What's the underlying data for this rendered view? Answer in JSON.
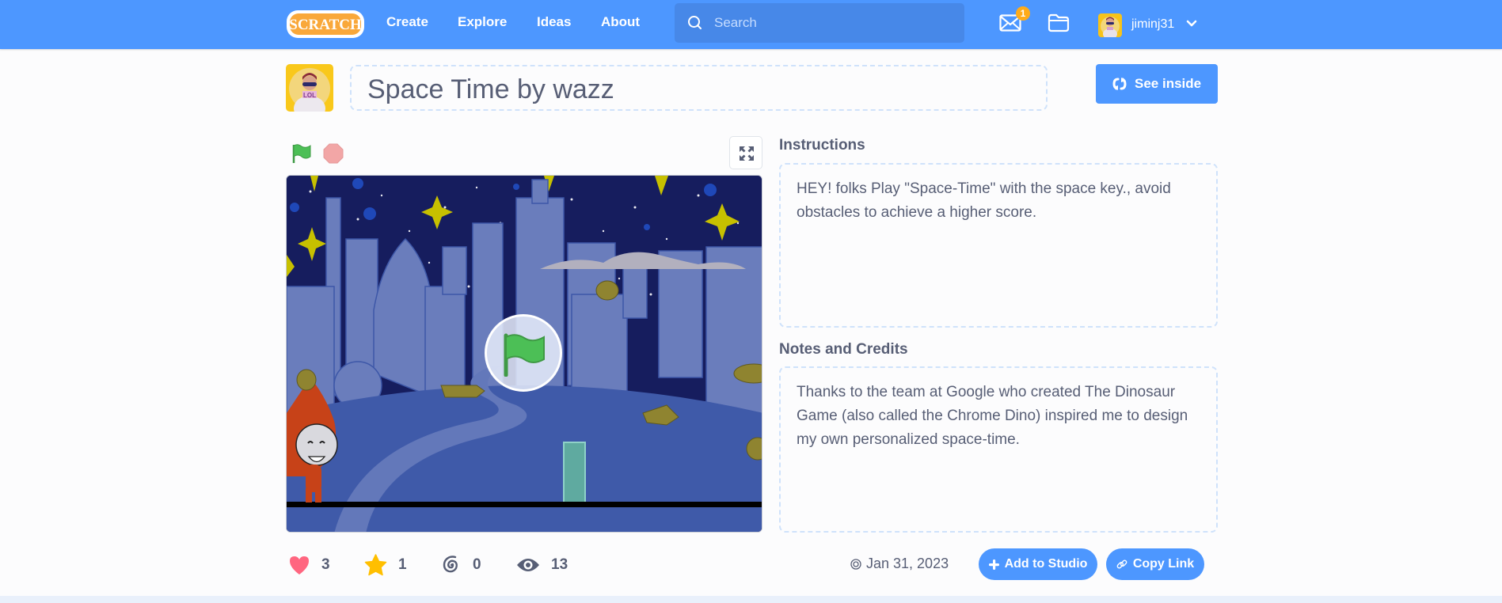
{
  "header": {
    "logo_text": "SCRATCH",
    "nav": [
      {
        "label": "Create"
      },
      {
        "label": "Explore"
      },
      {
        "label": "Ideas"
      },
      {
        "label": "About"
      }
    ],
    "search_placeholder": "Search",
    "messages_count": "1",
    "username": "jiminj31"
  },
  "project": {
    "title": "Space Time by wazz",
    "see_inside_label": "See inside",
    "instructions_label": "Instructions",
    "instructions": "HEY! folks Play \"Space-Time\" with the space key., avoid obstacles to achieve a higher score.",
    "notes_label": "Notes and Credits",
    "notes": "Thanks to the team at Google who created The Dinosaur Game (also called the Chrome Dino) inspired me to design my own personalized space-time."
  },
  "stats": {
    "loves": "3",
    "favorites": "1",
    "remixes": "0",
    "views": "13"
  },
  "meta": {
    "date": "Jan 31, 2023"
  },
  "actions": {
    "add_to_studio": "Add to Studio",
    "copy_link": "Copy Link"
  },
  "colors": {
    "brand_blue": "#4d97ff",
    "logo_orange": "#f9a83a",
    "love_red": "#ff6680",
    "favorite_yellow": "#ffbf00",
    "flag_green": "#4cbf56",
    "stop_red": "#f2a6a6",
    "badge_orange": "#ffab1a"
  }
}
